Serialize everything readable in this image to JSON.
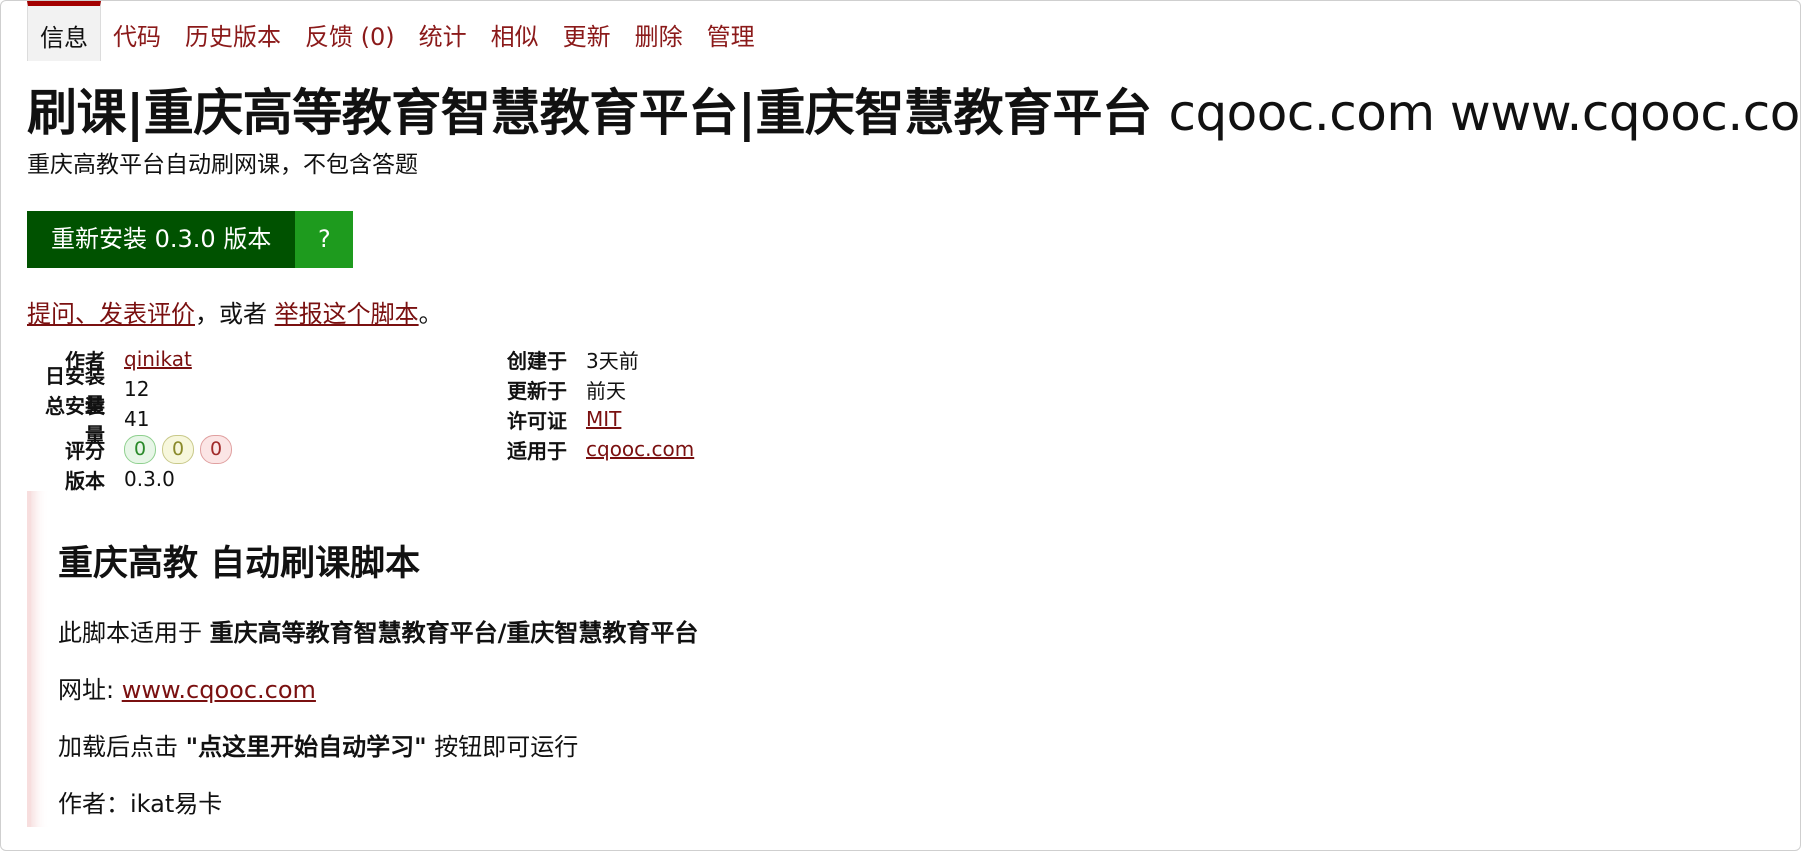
{
  "tabs": [
    {
      "label": "信息"
    },
    {
      "label": "代码"
    },
    {
      "label": "历史版本"
    },
    {
      "label": "反馈 (0)"
    },
    {
      "label": "统计"
    },
    {
      "label": "相似"
    },
    {
      "label": "更新"
    },
    {
      "label": "删除"
    },
    {
      "label": "管理"
    }
  ],
  "script": {
    "title_cn": "刷课|重庆高等教育智慧教育平台|重庆智慧教育平台",
    "title_latin": "cqooc.com www.cqooc.com",
    "subtitle": "重庆高教平台自动刷网课，不包含答题",
    "install_label": "重新安装 0.3.0 版本",
    "install_help": "?"
  },
  "feedback": {
    "link1": "提问、发表评价",
    "middle": "，或者 ",
    "link2": "举报这个脚本",
    "end": "。"
  },
  "meta": {
    "left": {
      "author_label": "作者",
      "author_value": "qinikat",
      "daily_label": "日安装量",
      "daily_value": "12",
      "total_label": "总安装量",
      "total_value": "41",
      "rating_label": "评分",
      "rating_good": "0",
      "rating_ok": "0",
      "rating_bad": "0",
      "version_label": "版本",
      "version_value": "0.3.0"
    },
    "right": {
      "created_label": "创建于",
      "created_value": "3天前",
      "updated_label": "更新于",
      "updated_value": "前天",
      "license_label": "许可证",
      "license_value": "MIT",
      "applies_label": "适用于",
      "applies_value": "cqooc.com"
    }
  },
  "description": {
    "heading": "重庆高教 自动刷课脚本",
    "p1_prefix": "此脚本适用于 ",
    "p1_bold": "重庆高等教育智慧教育平台/重庆智慧教育平台",
    "p2_prefix": "网址: ",
    "p2_link": "www.cqooc.com",
    "p3_prefix": "加载后点击 ",
    "p3_bold": "\"点这里开始自动学习\"",
    "p3_suffix": " 按钮即可运行",
    "p4": "作者：ikat易卡"
  },
  "colors": {
    "link": "#7a1010",
    "tab_active_border": "#a30000",
    "install_bg": "#005200",
    "install_help_bg": "#1e9b1e"
  }
}
